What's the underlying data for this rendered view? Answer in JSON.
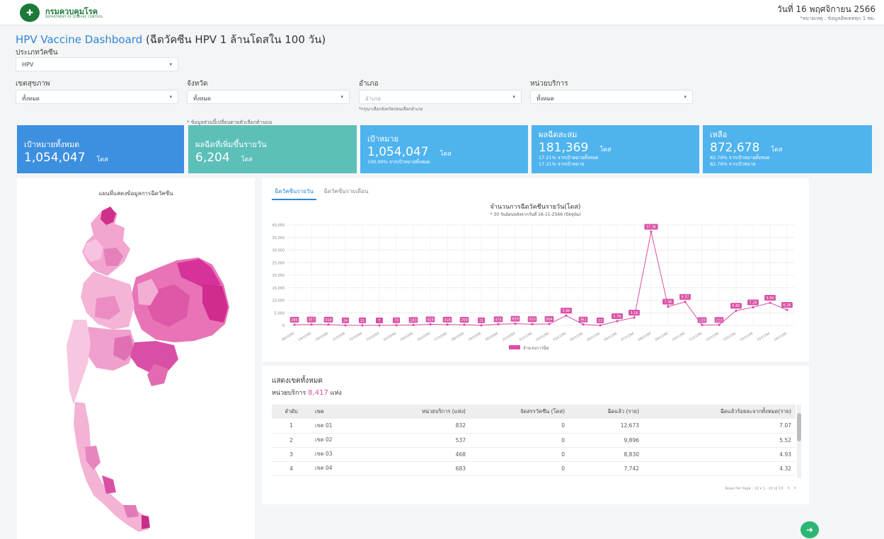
{
  "header": {
    "org_name": "กรมควบคุมโรค",
    "org_sub": "DEPARTMENT OF DISEASE CONTROL",
    "date": "วันที่ 16 พฤศจิกายน 2566",
    "note": "*หมายเหตุ : ข้อมูลอัพเดททุก 1 ชม."
  },
  "title": {
    "en": "HPV Vaccine Dashboard",
    "th": " (ฉีดวัคซีน HPV 1 ล้านโดสใน 100 วัน)"
  },
  "filters": {
    "vaccine_type_label": "ประเภทวัคซีน",
    "vaccine_type_value": "HPV",
    "health_region_label": "เขตสุขภาพ",
    "health_region_value": "ทั้งหมด",
    "province_label": "จังหวัด",
    "province_value": "ทั้งหมด",
    "district_label": "อำเภอ",
    "district_placeholder": "อำเภอ",
    "district_hint": "*กรุณาเลือกจังหวัดก่อนเลือกอำเภอ",
    "service_unit_label": "หน่วยบริการ",
    "service_unit_value": "ทั้งหมด",
    "change_note": "* ข้อมูลส่วนนี้เปลี่ยนตามตัวเลือกด้านบน"
  },
  "cards": [
    {
      "title": "เป้าหมายทั้งหมด",
      "value": "1,054,047",
      "unit": "โดส",
      "sub1": "",
      "sub2": "",
      "color": "#3d8fe0"
    },
    {
      "title": "ผลฉีดที่เพิ่มขึ้นรายวัน",
      "value": "6,204",
      "unit": "โดส",
      "sub1": "",
      "sub2": "",
      "color": "#5cbfb8"
    },
    {
      "title": "เป้าหมาย",
      "value": "1,054,047",
      "unit": "โดส",
      "sub1": "100.00% จากเป้าหมายทั้งหมด",
      "sub2": "",
      "color": "#4fb3ee"
    },
    {
      "title": "ผลฉีดสะสม",
      "value": "181,369",
      "unit": "โดส",
      "sub1": "17.21% จากเป้าหมายทั้งหมด",
      "sub2": "17.21% จากเป้าหมาย",
      "color": "#4fb3ee"
    },
    {
      "title": "เหลือ",
      "value": "872,678",
      "unit": "โดส",
      "sub1": "82.79% จากเป้าหมายทั้งหมด",
      "sub2": "82.79% จากเป้าหมาย",
      "color": "#4fb3ee"
    }
  ],
  "map": {
    "title": "แผนที่แสดงข้อมูลการฉีดวัคซีน"
  },
  "chart_panel": {
    "tab_daily": "ฉีดวัคซีนรายวัน",
    "tab_monthly": "ฉีดวัคซีนรายเดือน",
    "title": "จำนวนการฉีดวัคซีนรายวัน(โดส)",
    "subtitle": "* 30 วันย้อนหลังจากวันที่ 16-11-2566 (ปัจจุบัน)"
  },
  "chart_data": {
    "type": "line",
    "title": "จำนวนการฉีดวัคซีนรายวัน(โดส)",
    "subtitle": "* 30 วันย้อนหลังจากวันที่ 16-11-2566 (ปัจจุบัน)",
    "x": [
      "18/10/66",
      "19/10/66",
      "20/10/66",
      "21/10/66",
      "22/10/66",
      "23/10/66",
      "24/10/66",
      "25/10/66",
      "26/10/66",
      "27/10/66",
      "28/10/66",
      "29/10/66",
      "30/10/66",
      "31/10/66",
      "01/11/66",
      "02/11/66",
      "03/11/66",
      "04/11/66",
      "05/11/66",
      "06/11/66",
      "07/11/66",
      "08/11/66",
      "09/11/66",
      "10/11/66",
      "11/11/66",
      "12/11/66",
      "13/11/66",
      "14/11/66",
      "15/11/66",
      "16/11/66"
    ],
    "x_tick_labels": [
      "18/10/66",
      "19/10/66",
      "20/10/66",
      "21/10/66",
      "22/10/66",
      "23/10/66",
      "24/10/66",
      "25/10/66",
      "26/10/66",
      "27/10/66",
      "28/10/66",
      "29/10/66",
      "30/10/66",
      "31/10/66",
      "01/11/66",
      "02/11/66",
      "03/11/66",
      "04/11/66",
      "05/11/66",
      "06/11/66",
      "07/11/66",
      "08/11/66",
      "09/11/66",
      "10/11/66",
      "11/11/66",
      "12/11/66",
      "13/11/66",
      "14/11/66",
      "15/11/66",
      "16/11/66"
    ],
    "series": [
      {
        "name": "จำนวนการฉีด",
        "color": "#d94fa5",
        "values": [
          285,
          357,
          318,
          24,
          21,
          7,
          73,
          183,
          418,
          318,
          259,
          21,
          474,
          659,
          510,
          564,
          3900,
          361,
          13,
          1700,
          3100,
          37300,
          7460,
          9370,
          139,
          210,
          5850,
          7200,
          9000,
          6200
        ],
        "labels": [
          "285",
          "357",
          "318",
          "24",
          "21",
          "7",
          "73",
          "183",
          "418",
          "318",
          "259",
          "21",
          "474",
          "659",
          "510",
          "564",
          "3.9K",
          "361",
          "13",
          "1.7K",
          "3.1K",
          "37.3K",
          "7.46",
          "9.37",
          "139",
          "210",
          "5.85",
          "7.2K",
          "9.0K",
          "6.2K"
        ]
      }
    ],
    "ylim": [
      0,
      40000
    ],
    "y_ticks": [
      0,
      5000,
      10000,
      15000,
      20000,
      25000,
      30000,
      35000,
      40000
    ],
    "y_tick_labels": [
      "0",
      "5,000",
      "10,000",
      "15,000",
      "20,000",
      "25,000",
      "30,000",
      "35,000",
      "40,000"
    ],
    "grid": true,
    "legend": "bottom"
  },
  "table": {
    "title": "แสดงเขตทั้งหมด",
    "count_label": "หน่วยบริการ ",
    "count_value": "8,417",
    "count_unit": " แห่ง",
    "columns": [
      "ลำดับ",
      "เขต",
      "หน่วยบริการ (แห่ง)",
      "จัดสรรวัคซีน (โดส)",
      "ฉีดแล้ว (ราย)",
      "ฉีดแล้วร้อยละจากทั้งหมด(ราย)"
    ],
    "rows": [
      [
        "1",
        "เขต 01",
        "832",
        "0",
        "12,673",
        "7.07"
      ],
      [
        "2",
        "เขต 02",
        "537",
        "0",
        "9,896",
        "5.52"
      ],
      [
        "3",
        "เขต 03",
        "468",
        "0",
        "8,830",
        "4.93"
      ],
      [
        "4",
        "เขต 04",
        "683",
        "0",
        "7,742",
        "4.32"
      ]
    ],
    "pager": "Rows Per Page : 10 ▾ 1 - 10 of 13"
  }
}
